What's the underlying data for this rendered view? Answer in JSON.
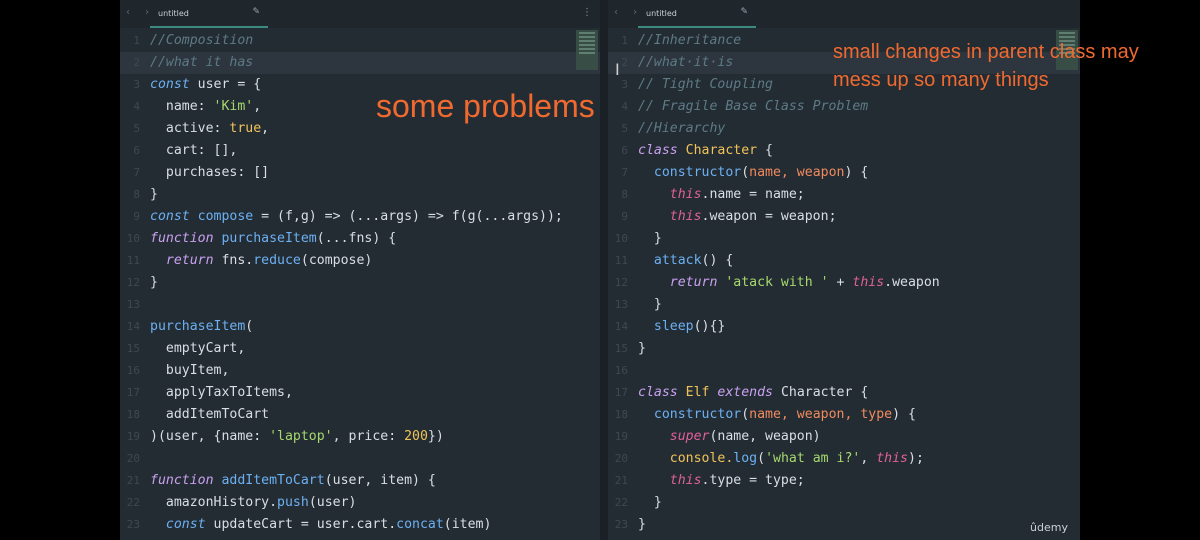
{
  "left_editor": {
    "tab": {
      "title": "untitled",
      "nav": "‹ ›",
      "edit_icon": "pencil-icon"
    },
    "lines": [
      {
        "n": "1",
        "segs": [
          {
            "t": "//Composition",
            "c": "#5d7a86",
            "i": true
          }
        ]
      },
      {
        "n": "2",
        "segs": [
          {
            "t": "//what it has",
            "c": "#5d7a86",
            "i": true
          }
        ],
        "hl": true
      },
      {
        "n": "3",
        "segs": [
          {
            "t": "const ",
            "c": "#6cb0f2",
            "i": true
          },
          {
            "t": "user = {",
            "c": "#d8dfe4"
          }
        ]
      },
      {
        "n": "4",
        "segs": [
          {
            "t": "  name: ",
            "c": "#d8dfe4"
          },
          {
            "t": "'Kim'",
            "c": "#a5d86e"
          },
          {
            "t": ",",
            "c": "#d8dfe4"
          }
        ]
      },
      {
        "n": "5",
        "segs": [
          {
            "t": "  active: ",
            "c": "#d8dfe4"
          },
          {
            "t": "true",
            "c": "#f0c35a"
          },
          {
            "t": ",",
            "c": "#d8dfe4"
          }
        ]
      },
      {
        "n": "6",
        "segs": [
          {
            "t": "  cart: [],",
            "c": "#d8dfe4"
          }
        ]
      },
      {
        "n": "7",
        "segs": [
          {
            "t": "  purchases: []",
            "c": "#d8dfe4"
          }
        ]
      },
      {
        "n": "8",
        "segs": [
          {
            "t": "}",
            "c": "#d8dfe4"
          }
        ]
      },
      {
        "n": "9",
        "segs": [
          {
            "t": "const ",
            "c": "#6cb0f2",
            "i": true
          },
          {
            "t": "compose",
            "c": "#6cb0f2"
          },
          {
            "t": " = (f,g) => (...args) => f(g(...args));",
            "c": "#d8dfe4"
          }
        ]
      },
      {
        "n": "10",
        "segs": [
          {
            "t": "function ",
            "c": "#c9a0f0",
            "i": true
          },
          {
            "t": "purchaseItem",
            "c": "#6cb0f2"
          },
          {
            "t": "(...fns) {",
            "c": "#d8dfe4"
          }
        ]
      },
      {
        "n": "11",
        "segs": [
          {
            "t": "  return ",
            "c": "#c9a0f0",
            "i": true
          },
          {
            "t": "fns.",
            "c": "#d8dfe4"
          },
          {
            "t": "reduce",
            "c": "#6cb0f2"
          },
          {
            "t": "(compose)",
            "c": "#d8dfe4"
          }
        ]
      },
      {
        "n": "12",
        "segs": [
          {
            "t": "}",
            "c": "#d8dfe4"
          }
        ]
      },
      {
        "n": "13",
        "segs": []
      },
      {
        "n": "14",
        "segs": [
          {
            "t": "purchaseItem",
            "c": "#6cb0f2"
          },
          {
            "t": "(",
            "c": "#d8dfe4"
          }
        ]
      },
      {
        "n": "15",
        "segs": [
          {
            "t": "  emptyCart,",
            "c": "#d8dfe4"
          }
        ]
      },
      {
        "n": "16",
        "segs": [
          {
            "t": "  buyItem,",
            "c": "#d8dfe4"
          }
        ]
      },
      {
        "n": "17",
        "segs": [
          {
            "t": "  applyTaxToItems,",
            "c": "#d8dfe4"
          }
        ]
      },
      {
        "n": "18",
        "segs": [
          {
            "t": "  addItemToCart",
            "c": "#d8dfe4"
          }
        ]
      },
      {
        "n": "19",
        "segs": [
          {
            "t": ")(user, {name: ",
            "c": "#d8dfe4"
          },
          {
            "t": "'laptop'",
            "c": "#a5d86e"
          },
          {
            "t": ", price: ",
            "c": "#d8dfe4"
          },
          {
            "t": "200",
            "c": "#f0c35a"
          },
          {
            "t": "})",
            "c": "#d8dfe4"
          }
        ]
      },
      {
        "n": "20",
        "segs": []
      },
      {
        "n": "21",
        "segs": [
          {
            "t": "function ",
            "c": "#c9a0f0",
            "i": true
          },
          {
            "t": "addItemToCart",
            "c": "#6cb0f2"
          },
          {
            "t": "(user, item) {",
            "c": "#d8dfe4"
          }
        ]
      },
      {
        "n": "22",
        "segs": [
          {
            "t": "  amazonHistory.",
            "c": "#d8dfe4"
          },
          {
            "t": "push",
            "c": "#6cb0f2"
          },
          {
            "t": "(user)",
            "c": "#d8dfe4"
          }
        ]
      },
      {
        "n": "23",
        "segs": [
          {
            "t": "  const ",
            "c": "#6cb0f2",
            "i": true
          },
          {
            "t": "updateCart = user.cart.",
            "c": "#d8dfe4"
          },
          {
            "t": "concat",
            "c": "#6cb0f2"
          },
          {
            "t": "(item)",
            "c": "#d8dfe4"
          }
        ]
      }
    ]
  },
  "right_editor": {
    "tab": {
      "title": "untitled",
      "nav": "‹ ›",
      "edit_icon": "pencil-icon",
      "menu": "⋮"
    },
    "lines": [
      {
        "n": "1",
        "segs": [
          {
            "t": "//Inheritance",
            "c": "#5d7a86",
            "i": true
          }
        ]
      },
      {
        "n": "2",
        "segs": [
          {
            "t": "//what·it·is",
            "c": "#5d7a86",
            "i": true
          }
        ],
        "hl": true
      },
      {
        "n": "3",
        "segs": [
          {
            "t": "// Tight Coupling",
            "c": "#5d7a86",
            "i": true
          }
        ]
      },
      {
        "n": "4",
        "segs": [
          {
            "t": "// Fragile Base Class Problem",
            "c": "#5d7a86",
            "i": true
          }
        ]
      },
      {
        "n": "5",
        "segs": [
          {
            "t": "//Hierarchy",
            "c": "#5d7a86",
            "i": true
          }
        ]
      },
      {
        "n": "6",
        "segs": [
          {
            "t": "class ",
            "c": "#c9a0f0",
            "i": true
          },
          {
            "t": "Character",
            "c": "#f0c35a"
          },
          {
            "t": " {",
            "c": "#d8dfe4"
          }
        ]
      },
      {
        "n": "7",
        "segs": [
          {
            "t": "  constructor",
            "c": "#6cb0f2"
          },
          {
            "t": "(",
            "c": "#d8dfe4"
          },
          {
            "t": "name, weapon",
            "c": "#f08a5d"
          },
          {
            "t": ") {",
            "c": "#d8dfe4"
          }
        ]
      },
      {
        "n": "8",
        "segs": [
          {
            "t": "    this",
            "c": "#e0609a",
            "i": true
          },
          {
            "t": ".name = name;",
            "c": "#d8dfe4"
          }
        ]
      },
      {
        "n": "9",
        "segs": [
          {
            "t": "    this",
            "c": "#e0609a",
            "i": true
          },
          {
            "t": ".weapon = weapon;",
            "c": "#d8dfe4"
          }
        ]
      },
      {
        "n": "10",
        "segs": [
          {
            "t": "  }",
            "c": "#d8dfe4"
          }
        ]
      },
      {
        "n": "11",
        "segs": [
          {
            "t": "  attack",
            "c": "#6cb0f2"
          },
          {
            "t": "() {",
            "c": "#d8dfe4"
          }
        ]
      },
      {
        "n": "12",
        "segs": [
          {
            "t": "    return ",
            "c": "#c9a0f0",
            "i": true
          },
          {
            "t": "'atack with '",
            "c": "#a5d86e"
          },
          {
            "t": " + ",
            "c": "#d8dfe4"
          },
          {
            "t": "this",
            "c": "#e0609a",
            "i": true
          },
          {
            "t": ".weapon",
            "c": "#d8dfe4"
          }
        ]
      },
      {
        "n": "13",
        "segs": [
          {
            "t": "  }",
            "c": "#d8dfe4"
          }
        ]
      },
      {
        "n": "14",
        "segs": [
          {
            "t": "  sleep",
            "c": "#6cb0f2"
          },
          {
            "t": "(){}",
            "c": "#d8dfe4"
          }
        ]
      },
      {
        "n": "15",
        "segs": [
          {
            "t": "}",
            "c": "#d8dfe4"
          }
        ]
      },
      {
        "n": "16",
        "segs": []
      },
      {
        "n": "17",
        "segs": [
          {
            "t": "class ",
            "c": "#c9a0f0",
            "i": true
          },
          {
            "t": "Elf ",
            "c": "#f0c35a"
          },
          {
            "t": "extends ",
            "c": "#c9a0f0",
            "i": true
          },
          {
            "t": "Character",
            "c": "#d8dfe4"
          },
          {
            "t": " {",
            "c": "#d8dfe4"
          }
        ]
      },
      {
        "n": "18",
        "segs": [
          {
            "t": "  constructor",
            "c": "#6cb0f2"
          },
          {
            "t": "(",
            "c": "#d8dfe4"
          },
          {
            "t": "name, weapon, type",
            "c": "#f08a5d"
          },
          {
            "t": ") {",
            "c": "#d8dfe4"
          }
        ]
      },
      {
        "n": "19",
        "segs": [
          {
            "t": "    super",
            "c": "#e0609a",
            "i": true
          },
          {
            "t": "(name, weapon)",
            "c": "#d8dfe4"
          }
        ]
      },
      {
        "n": "20",
        "segs": [
          {
            "t": "    console.",
            "c": "#f0c35a"
          },
          {
            "t": "log",
            "c": "#6cb0f2"
          },
          {
            "t": "(",
            "c": "#d8dfe4"
          },
          {
            "t": "'what am i?'",
            "c": "#a5d86e"
          },
          {
            "t": ", ",
            "c": "#d8dfe4"
          },
          {
            "t": "this",
            "c": "#e0609a",
            "i": true
          },
          {
            "t": ");",
            "c": "#d8dfe4"
          }
        ]
      },
      {
        "n": "21",
        "segs": [
          {
            "t": "    this",
            "c": "#e0609a",
            "i": true
          },
          {
            "t": ".type = type;",
            "c": "#d8dfe4"
          }
        ]
      },
      {
        "n": "22",
        "segs": [
          {
            "t": "  }",
            "c": "#d8dfe4"
          }
        ]
      },
      {
        "n": "23",
        "segs": [
          {
            "t": "}",
            "c": "#d8dfe4"
          }
        ]
      }
    ]
  },
  "annotations": {
    "left": "some problems",
    "right_line1": "small changes in parent class may",
    "right_line2": "mess up so many things"
  },
  "watermark": "ûdemy"
}
